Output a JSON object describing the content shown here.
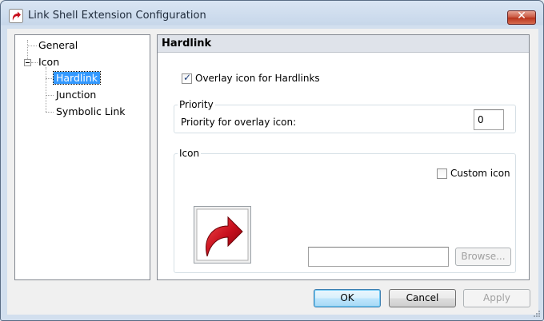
{
  "window": {
    "title": "Link Shell Extension Configuration",
    "close_label": "✕"
  },
  "tree": {
    "items": [
      {
        "label": "General"
      },
      {
        "label": "Icon"
      },
      {
        "label": "Hardlink"
      },
      {
        "label": "Junction"
      },
      {
        "label": "Symbolic Link"
      }
    ]
  },
  "panel": {
    "header": "Hardlink",
    "overlay_checkbox_label": "Overlay icon for Hardlinks",
    "priority": {
      "group_title": "Priority",
      "label": "Priority for overlay icon:",
      "value": "0"
    },
    "icon": {
      "group_title": "Icon",
      "custom_icon_label": "Custom icon",
      "path_value": "",
      "browse_label": "Browse..."
    }
  },
  "buttons": {
    "ok": "OK",
    "cancel": "Cancel",
    "apply": "Apply"
  },
  "colors": {
    "selection": "#3399ff",
    "icon_red": "#c8101e"
  }
}
